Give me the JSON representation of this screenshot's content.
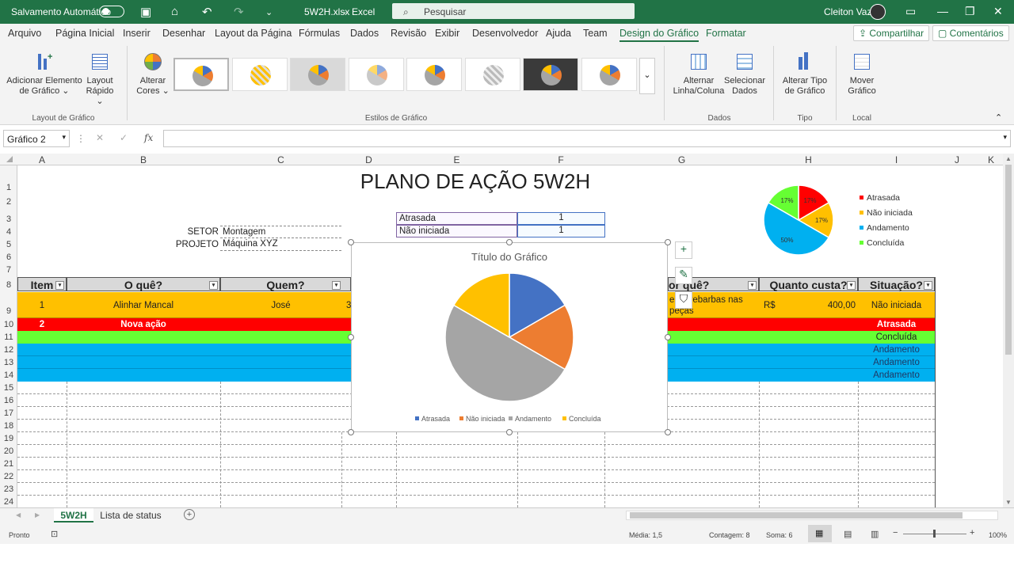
{
  "titlebar": {
    "autosave": "Salvamento Automático",
    "filename": "5W2H.xlsx",
    "app": "Excel",
    "search_placeholder": "Pesquisar",
    "user": "Cleiton Vaz"
  },
  "menu": {
    "items": [
      "Arquivo",
      "Página Inicial",
      "Inserir",
      "Desenhar",
      "Layout da Página",
      "Fórmulas",
      "Dados",
      "Revisão",
      "Exibir",
      "Desenvolvedor",
      "Ajuda",
      "Team",
      "Design do Gráfico",
      "Formatar"
    ],
    "share": "Compartilhar",
    "comments": "Comentários"
  },
  "ribbon": {
    "add_element": "Adicionar Elemento de Gráfico",
    "quick_layout": "Layout Rápido",
    "layout_group": "Layout de Gráfico",
    "change_colors": "Alterar Cores",
    "styles_group": "Estilos de Gráfico",
    "switch_row_col": "Alternar Linha/Coluna",
    "select_data": "Selecionar Dados",
    "data_group": "Dados",
    "change_type": "Alterar Tipo de Gráfico",
    "type_group": "Tipo",
    "move_chart": "Mover Gráfico",
    "location_group": "Local"
  },
  "formula": {
    "namebox": "Gráfico 2",
    "fx": "fx"
  },
  "columns": [
    "A",
    "B",
    "C",
    "D",
    "E",
    "F",
    "G",
    "H",
    "I",
    "J",
    "K"
  ],
  "rows": [
    "1",
    "2",
    "3",
    "4",
    "5",
    "6",
    "7",
    "8",
    "9",
    "10",
    "11",
    "12",
    "13",
    "14",
    "15",
    "16",
    "17",
    "18",
    "19",
    "20",
    "21",
    "22",
    "23",
    "24"
  ],
  "sheet": {
    "title": "PLANO DE AÇÃO 5W2H",
    "setor_label": "SETOR",
    "setor_value": "Montagem",
    "projeto_label": "PROJETO",
    "projeto_value": "Máquina XYZ",
    "status_table": [
      {
        "label": "Atrasada",
        "value": "1"
      },
      {
        "label": "Não iniciada",
        "value": "1"
      }
    ],
    "headers": {
      "item": "Item",
      "oque": "O quê?",
      "quem": "Quem?",
      "porque": "or quê?",
      "quanto": "Quanto custa?",
      "situacao": "Situação?"
    },
    "row9": {
      "item": "1",
      "oque": "Alinhar Mancal",
      "quem": "José",
      "d": "3",
      "porque": "er    le rebarbas nas peças",
      "currency": "R$",
      "cost": "400,00",
      "situacao": "Não iniciada"
    },
    "row10": {
      "item": "2",
      "oque": "Nova ação",
      "situacao": "Atrasada"
    },
    "row11": {
      "situacao": "Concluída"
    },
    "row12": {
      "situacao": "Andamento"
    },
    "row13": {
      "situacao": "Andamento"
    },
    "row14": {
      "situacao": "Andamento"
    }
  },
  "colors": {
    "green": "#217346",
    "atrasada": "#ff0000",
    "nao_iniciada": "#ffc000",
    "concluida": "#66ff33",
    "andamento": "#00b0f0"
  },
  "chart_data": [
    {
      "type": "pie",
      "title": "Título do Gráfico",
      "categories": [
        "Atrasada",
        "Não iniciada",
        "Andamento",
        "Concluída"
      ],
      "values": [
        1,
        1,
        3,
        1
      ],
      "colors": [
        "#4472c4",
        "#ed7d31",
        "#a5a5a5",
        "#ffc000"
      ],
      "legend": "bottom"
    },
    {
      "type": "pie",
      "categories": [
        "Atrasada",
        "Não iniciada",
        "Andamento",
        "Concluída"
      ],
      "values": [
        1,
        1,
        3,
        1
      ],
      "labels": [
        "17%",
        "17%",
        "50%",
        "17%"
      ],
      "colors": [
        "#ff0000",
        "#ffc000",
        "#00b0f0",
        "#66ff33"
      ],
      "legend": "right"
    }
  ],
  "tabs": {
    "active": "5W2H",
    "other": "Lista de status"
  },
  "status": {
    "ready": "Pronto",
    "media": "Média: 1,5",
    "contagem": "Contagem: 8",
    "soma": "Soma: 6",
    "zoom": "100%"
  }
}
